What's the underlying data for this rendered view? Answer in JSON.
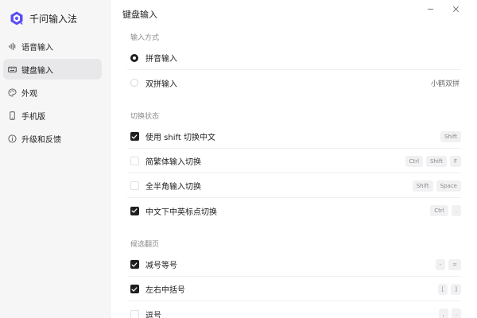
{
  "app": {
    "name": "千问输入法"
  },
  "sidebar": {
    "items": [
      {
        "label": "语音输入",
        "icon": "waveform-icon",
        "active": false
      },
      {
        "label": "键盘输入",
        "icon": "keyboard-icon",
        "active": true
      },
      {
        "label": "外观",
        "icon": "palette-icon",
        "active": false
      },
      {
        "label": "手机版",
        "icon": "phone-icon",
        "active": false
      },
      {
        "label": "升级和反馈",
        "icon": "info-icon",
        "active": false
      }
    ]
  },
  "page": {
    "title": "键盘输入"
  },
  "sections": {
    "input_method": {
      "title": "输入方式",
      "rows": [
        {
          "label": "拼音输入",
          "selected": true
        },
        {
          "label": "双拼输入",
          "selected": false,
          "right_text": "小鹤双拼"
        }
      ]
    },
    "toggle_state": {
      "title": "切换状态",
      "rows": [
        {
          "label": "使用 shift 切换中文",
          "checked": true,
          "keys": [
            "Shift"
          ]
        },
        {
          "label": "简繁体输入切换",
          "checked": false,
          "keys": [
            "Ctrl",
            "Shift",
            "F"
          ]
        },
        {
          "label": "全半角输入切换",
          "checked": false,
          "keys": [
            "Shift",
            "Space"
          ]
        },
        {
          "label": "中文下中英标点切换",
          "checked": true,
          "keys": [
            "Ctrl",
            "."
          ]
        }
      ]
    },
    "candidate_paging": {
      "title": "候选翻页",
      "rows": [
        {
          "label": "减号等号",
          "checked": true,
          "keys": [
            "-",
            "="
          ]
        },
        {
          "label": "左右中括号",
          "checked": true,
          "keys": [
            "[",
            "]"
          ]
        },
        {
          "label": "逗号",
          "checked": false,
          "keys": [
            ",",
            "."
          ]
        }
      ]
    }
  },
  "colors": {
    "sidebar_bg": "#f6f6f7",
    "active_item_bg": "#e8e8ea",
    "accent": "#1f1f1f",
    "logo": "#5b4df5"
  }
}
